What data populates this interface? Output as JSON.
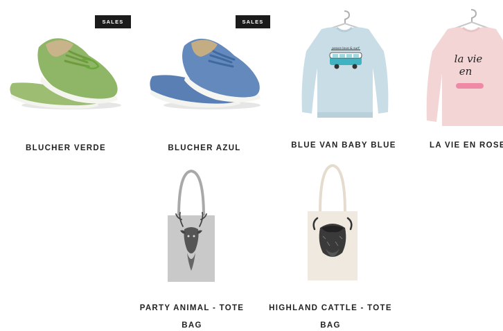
{
  "catalog": {
    "products": [
      {
        "name": "BLUCHER VERDE",
        "badge": "SALES",
        "image": "green-canvas-shoes",
        "color": "#8db36a"
      },
      {
        "name": "BLUCHER AZUL",
        "badge": "SALES",
        "image": "blue-canvas-shoes",
        "color": "#5f83b8"
      },
      {
        "name": "BLUE VAN BABY BLUE",
        "image": "light-blue-sweatshirt-with-van-print",
        "color": "#c9dde6"
      },
      {
        "name": "LA VIE EN ROSE",
        "image": "pink-sweatshirt-with-script-print",
        "color": "#f2d6d8"
      },
      {
        "name_lines": [
          "PARTY ANIMAL - TOTE",
          "BAG"
        ],
        "image": "grey-tote-bag-with-deer-print",
        "color": "#c9c9c9"
      },
      {
        "name_lines": [
          "HIGHLAND CATTLE - TOTE",
          "BAG"
        ],
        "image": "natural-tote-bag-with-highland-cow-print",
        "color": "#efe7dd"
      }
    ]
  },
  "artwork": {
    "van_text": "peace love & surf",
    "rose_script_line1": "la vie",
    "rose_script_line2": "en"
  }
}
